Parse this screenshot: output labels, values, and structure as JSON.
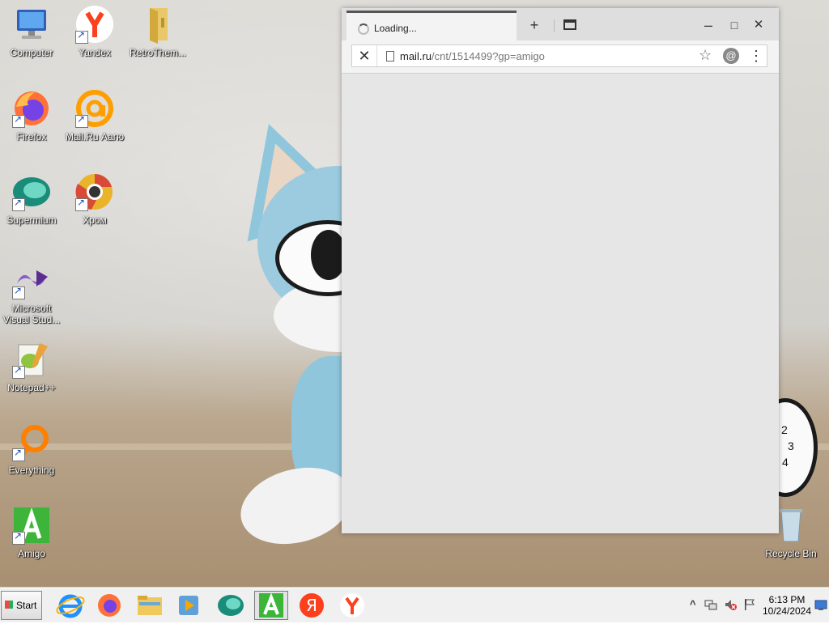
{
  "desktop": {
    "icons": [
      {
        "label": "Computer"
      },
      {
        "label": "Yandex"
      },
      {
        "label": "RetroThem..."
      },
      {
        "label": "Firefox"
      },
      {
        "label": "Mail.Ru Аагю"
      },
      {
        "label": "Supermium"
      },
      {
        "label": "Хром"
      },
      {
        "label": "Microsoft Visual Stud..."
      },
      {
        "label": "Notepad++"
      },
      {
        "label": "Everything"
      },
      {
        "label": "Amigo"
      },
      {
        "label": "Recycle Bin"
      }
    ],
    "clock_numbers": [
      "2",
      "3",
      "4"
    ]
  },
  "browser": {
    "tab_title": "Loading...",
    "new_tab_symbol": "+",
    "address_host": "mail.ru",
    "address_path": "/cnt/1514499?gp=amigo",
    "stop_symbol": "✕",
    "bookmark_symbol": "☆",
    "mail_symbol": "@",
    "menu_symbol": "⋮",
    "minimize_symbol": "–",
    "maximize_symbol": "□",
    "close_symbol": "✕"
  },
  "taskbar": {
    "start_label": "Start",
    "time": "6:13 PM",
    "date": "10/24/2024",
    "tray_expand": "^",
    "pinned": [
      "internet-explorer",
      "firefox",
      "file-explorer",
      "media-player",
      "supermium",
      "amigo",
      "yandex",
      "yandex-browser"
    ]
  },
  "colors": {
    "yandex_red": "#fc3f1d",
    "amigo_green": "#3db53a",
    "mail_orange": "#ff9e00",
    "firefox_orange": "#ff7139"
  }
}
